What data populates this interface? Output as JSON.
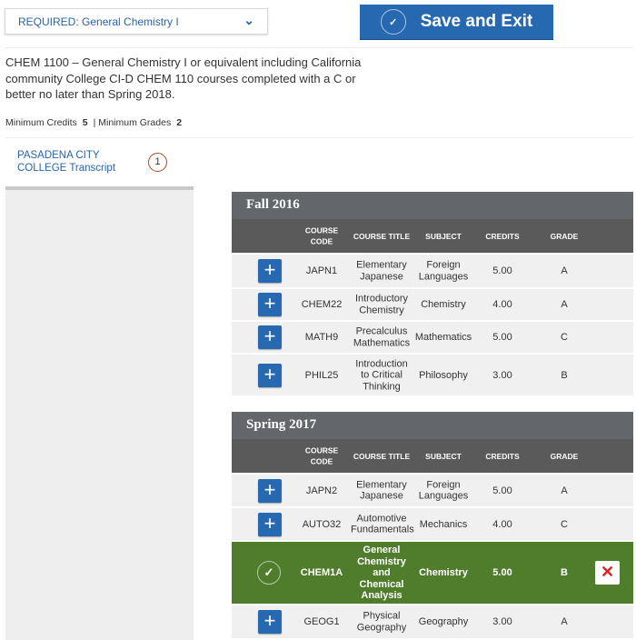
{
  "requirement_select": {
    "value": "REQUIRED: General Chemistry I"
  },
  "save_button": {
    "label": "Save and Exit"
  },
  "description": "CHEM 1100 – General Chemistry I or equivalent including California community College CI-D CHEM 110 courses completed with a C or better no later than Spring 2018.",
  "minimums": {
    "credits_label": "Minimum Credits",
    "credits_value": "5",
    "grades_label": "| Minimum Grades",
    "grades_value": "2"
  },
  "transcript": {
    "label": "PASADENA CITY COLLEGE Transcript",
    "count": "1"
  },
  "columns": {
    "code": "COURSE CODE",
    "title": "COURSE TITLE",
    "subject": "SUBJECT",
    "credits": "CREDITS",
    "grade": "GRADE"
  },
  "terms": [
    {
      "name": "Fall 2016",
      "courses": [
        {
          "code": "JAPN1",
          "title": "Elementary Japanese",
          "subject": "Foreign Languages",
          "credits": "5.00",
          "grade": "A",
          "selected": false
        },
        {
          "code": "CHEM22",
          "title": "Introductory Chemistry",
          "subject": "Chemistry",
          "credits": "4.00",
          "grade": "A",
          "selected": false
        },
        {
          "code": "MATH9",
          "title": "Precalculus Mathematics",
          "subject": "Mathematics",
          "credits": "5.00",
          "grade": "C",
          "selected": false
        },
        {
          "code": "PHIL25",
          "title": "Introduction to Critical Thinking",
          "subject": "Philosophy",
          "credits": "3.00",
          "grade": "B",
          "selected": false
        }
      ]
    },
    {
      "name": "Spring 2017",
      "courses": [
        {
          "code": "JAPN2",
          "title": "Elementary Japanese",
          "subject": "Foreign Languages",
          "credits": "5.00",
          "grade": "A",
          "selected": false
        },
        {
          "code": "AUTO32",
          "title": "Automotive Fundamentals",
          "subject": "Mechanics",
          "credits": "4.00",
          "grade": "C",
          "selected": false
        },
        {
          "code": "CHEM1A",
          "title": "General Chemistry and Chemical Analysis",
          "subject": "Chemistry",
          "credits": "5.00",
          "grade": "B",
          "selected": true
        },
        {
          "code": "GEOG1",
          "title": "Physical Geography",
          "subject": "Geography",
          "credits": "3.00",
          "grade": "A",
          "selected": false
        }
      ]
    }
  ],
  "colors": {
    "accent": "#2769b0",
    "selected": "#4f7d2c",
    "header": "#63666a"
  }
}
